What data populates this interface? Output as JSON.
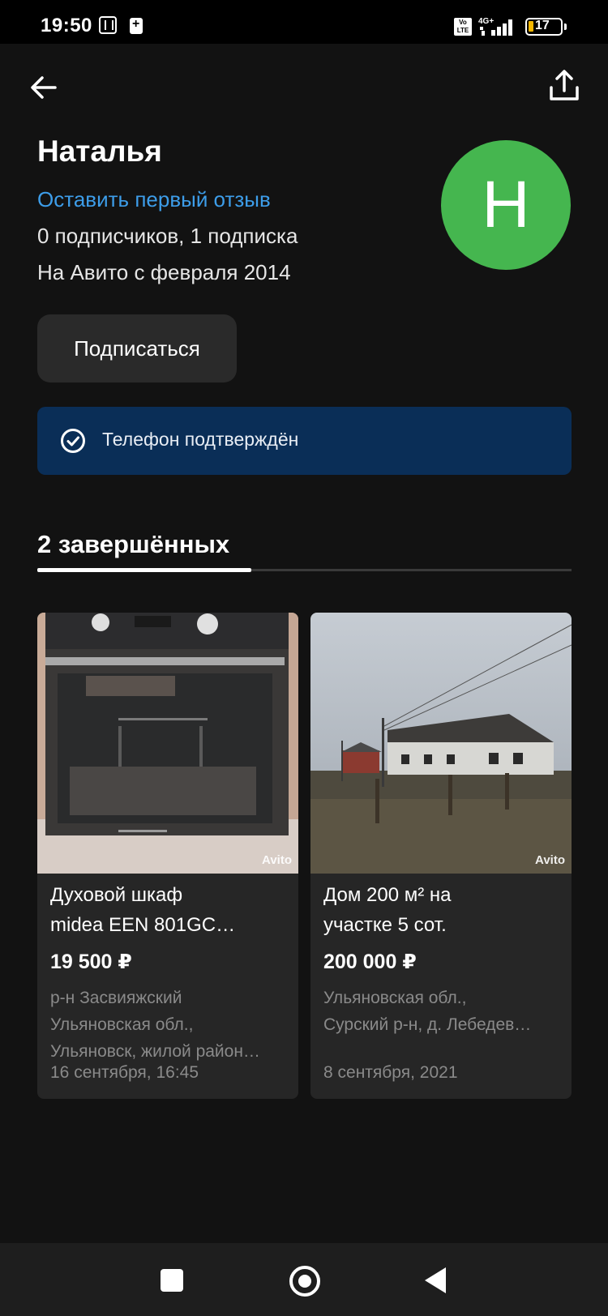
{
  "status_bar": {
    "time": "19:50",
    "volte": "Vo LTE",
    "network": "4G+",
    "battery_level": "17",
    "icons": [
      "nfc-icon",
      "battery-saver-icon",
      "volte-icon",
      "signal-icon",
      "battery-icon"
    ]
  },
  "header": {
    "back_icon": "arrow-left-icon",
    "share_icon": "share-icon"
  },
  "profile": {
    "name": "Наталья",
    "review_link": "Оставить первый отзыв",
    "subscriptions": "0 подписчиков, 1 подписка",
    "member_since": "На Авито с февраля 2014",
    "avatar_letter": "Н",
    "avatar_color": "#45b64f",
    "subscribe_label": "Подписаться"
  },
  "verification": {
    "icon": "check-circle-icon",
    "text": "Телефон подтверждён",
    "background": "#0a2e57"
  },
  "tabs": {
    "completed_label": "2 завершённых"
  },
  "listings": [
    {
      "title_line1": "Духовой шкаф",
      "title_line2": "midea EEN 801GC…",
      "price": "19 500 ₽",
      "location_line1": "р-н Засвияжский",
      "location_line2": "Ульяновская обл.,",
      "location_line3": "Ульяновск, жилой район…",
      "date": "16 сентября, 16:45",
      "watermark": "Avito",
      "photo": "oven-photo"
    },
    {
      "title_line1": "Дом 200 м² на",
      "title_line2": "участке 5 сот.",
      "price": "200 000 ₽",
      "location_line1": "Ульяновская обл.,",
      "location_line2": "Сурский р-н, д. Лебедев…",
      "date": "8 сентября, 2021",
      "watermark": "Avito",
      "photo": "house-photo"
    }
  ],
  "nav_bar": {
    "icons": [
      "recents-square-icon",
      "home-circle-icon",
      "back-triangle-icon"
    ]
  },
  "colors": {
    "background": "#121212",
    "link": "#3d9de9",
    "secondary_text": "#8a8a8a",
    "card": "#262626"
  }
}
